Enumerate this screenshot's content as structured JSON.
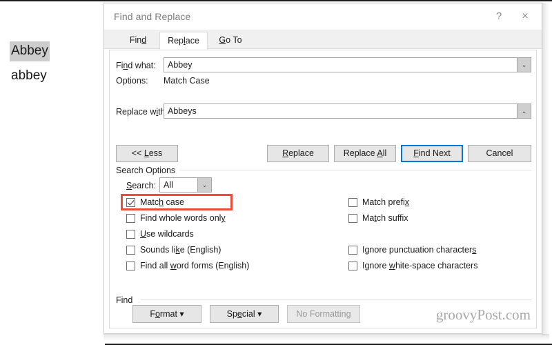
{
  "document": {
    "selected_word": "Abbey",
    "plain_word": "abbey"
  },
  "dialog": {
    "title": "Find and Replace",
    "help_icon": "?",
    "close_icon": "×",
    "tabs": [
      {
        "label": "Find",
        "active": false
      },
      {
        "label": "Replace",
        "active": true
      },
      {
        "label": "Go To",
        "active": false
      }
    ],
    "fields": {
      "find_label": "Find what:",
      "find_value": "Abbey",
      "options_label": "Options:",
      "options_value": "Match Case",
      "replace_label": "Replace with:",
      "replace_value": "Abbeys",
      "dropdown_arrow": "⌄"
    },
    "buttons": {
      "less": "<< Less",
      "replace": "Replace",
      "replace_all": "Replace All",
      "find_next": "Find Next",
      "cancel": "Cancel"
    },
    "search_options": {
      "group_label": "Search Options",
      "search_label": "Search:",
      "search_value": "All",
      "left_checkboxes": [
        {
          "label": "Match case",
          "checked": true
        },
        {
          "label": "Find whole words only",
          "checked": false
        },
        {
          "label": "Use wildcards",
          "checked": false
        },
        {
          "label": "Sounds like (English)",
          "checked": false
        },
        {
          "label": "Find all word forms (English)",
          "checked": false
        }
      ],
      "right_checkboxes": [
        {
          "label": "Match prefix",
          "checked": false
        },
        {
          "label": "Match suffix",
          "checked": false
        },
        {
          "label": "Ignore punctuation characters",
          "checked": false
        },
        {
          "label": "Ignore white-space characters",
          "checked": false
        }
      ]
    },
    "find_group": {
      "group_label": "Find",
      "format": "Format ▾",
      "special": "Special ▾",
      "no_formatting": "No Formatting"
    }
  },
  "watermark": "groovyPost.com",
  "colors": {
    "focus_blue": "#0078d7",
    "highlight_red": "#ef4b38",
    "selection_grey": "#cdcdcd"
  }
}
